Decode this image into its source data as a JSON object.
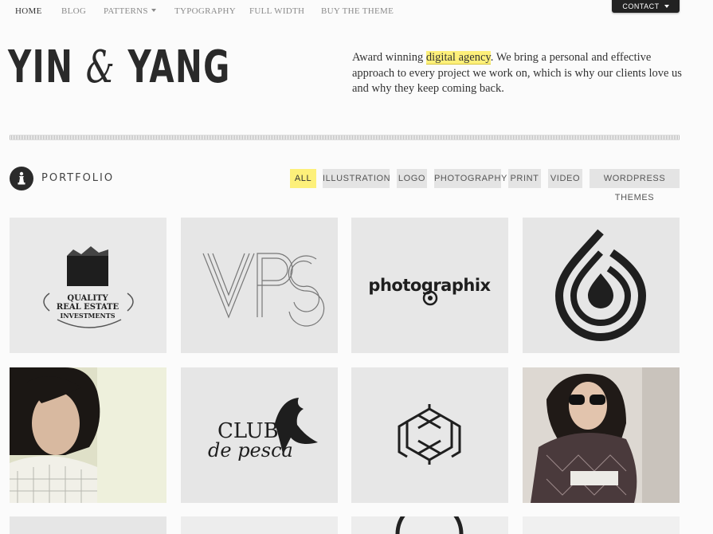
{
  "nav": {
    "items": [
      {
        "label": "HOME"
      },
      {
        "label": "BLOG"
      },
      {
        "label": "PATTERNS"
      },
      {
        "label": "TYPOGRAPHY"
      },
      {
        "label": "FULL WIDTH"
      },
      {
        "label": "BUY THE THEME"
      }
    ],
    "contact": "CONTACT"
  },
  "header": {
    "logo_part1": "YIN ",
    "logo_amp": "&",
    "logo_part2": " YANG",
    "tagline_pre": "Award winning ",
    "tagline_highlight": "digital agency",
    "tagline_post": ". We bring a personal and effective approach to every project we work on, which is why our clients love us and why they keep coming back."
  },
  "portfolio": {
    "title": "PORTFOLIO",
    "filters": [
      {
        "label": "ALL",
        "active": true
      },
      {
        "label": "ILLUSTRATION"
      },
      {
        "label": "LOGO"
      },
      {
        "label": "PHOTOGRAPHY"
      },
      {
        "label": "PRINT"
      },
      {
        "label": "VIDEO"
      },
      {
        "label": "WORDPRESS THEMES"
      }
    ],
    "items": [
      {
        "icon": "quality-real-estate-logo-thumbnail",
        "text_lines": [
          "QUALITY",
          "REAL ESTATE",
          "INVESTMENTS"
        ]
      },
      {
        "icon": "vps-striped-logo-thumbnail",
        "text": "VPS"
      },
      {
        "icon": "photographix-logo-thumbnail",
        "text": "photographix"
      },
      {
        "icon": "drop-ring-logo-thumbnail"
      },
      {
        "icon": "woman-portrait-photo-thumbnail"
      },
      {
        "icon": "club-de-pesca-logo-thumbnail",
        "text_lines": [
          "CLUB",
          "de pesca"
        ]
      },
      {
        "icon": "geometric-cube-knot-logo-thumbnail"
      },
      {
        "icon": "sunglasses-woman-photo-thumbnail"
      }
    ]
  },
  "colors": {
    "highlight": "#fdf07a",
    "dark": "#222222",
    "filter_bg": "#e4e4e4"
  }
}
